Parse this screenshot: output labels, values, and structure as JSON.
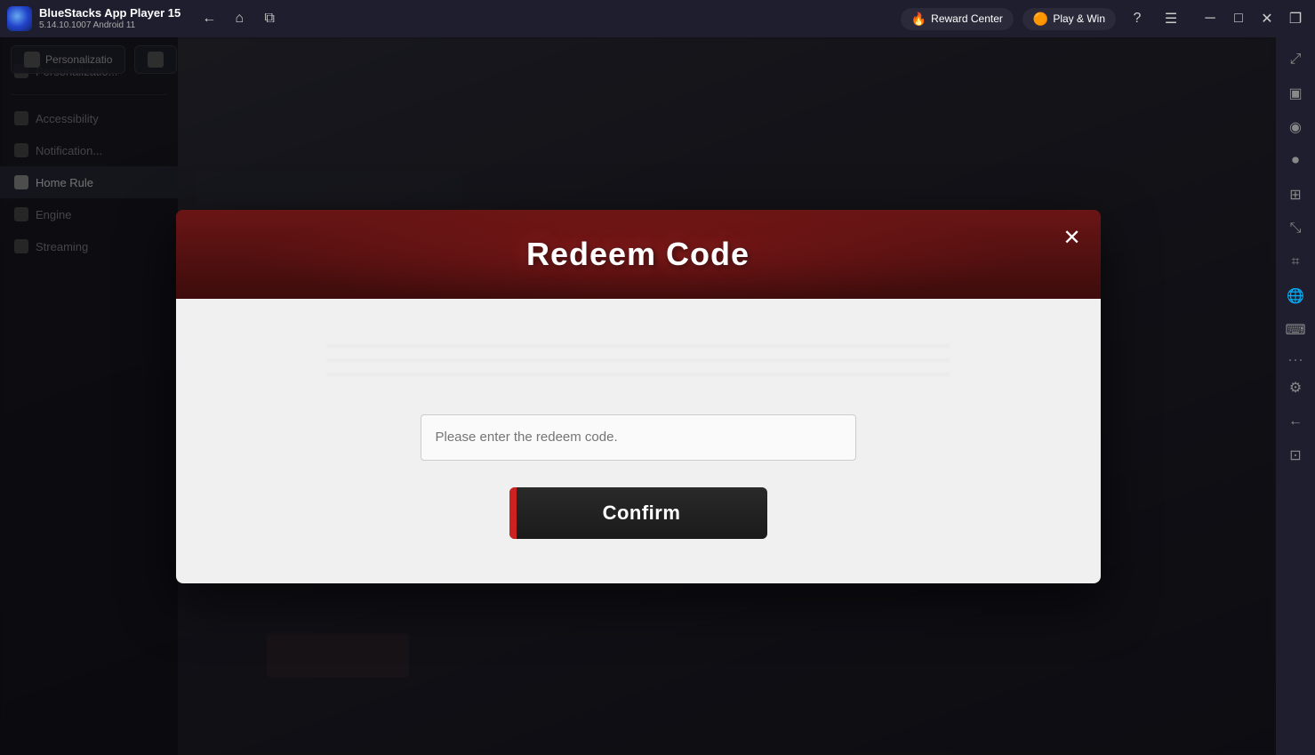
{
  "titlebar": {
    "app_name": "BlueStacks App Player 15",
    "version": "5.14.10.1007  Android 11",
    "nav": {
      "back_label": "←",
      "home_label": "⌂",
      "tabs_label": "⧉"
    },
    "badges": {
      "reward_center": "Reward Center",
      "play_and_win": "Play & Win"
    },
    "window_buttons": {
      "minimize": "─",
      "maximize": "□",
      "close": "✕",
      "restore": "❐"
    }
  },
  "right_sidebar": {
    "buttons": [
      {
        "name": "expand-icon",
        "symbol": "⤢"
      },
      {
        "name": "screenshot-icon",
        "symbol": "⬛"
      },
      {
        "name": "camera-icon",
        "symbol": "◎"
      },
      {
        "name": "record-icon",
        "symbol": "⏺"
      },
      {
        "name": "controls-icon",
        "symbol": "⊞"
      },
      {
        "name": "zoom-icon",
        "symbol": "⤡"
      },
      {
        "name": "macro-icon",
        "symbol": "⌗"
      },
      {
        "name": "globe-icon",
        "symbol": "🌐"
      },
      {
        "name": "script-icon",
        "symbol": "⌨"
      },
      {
        "name": "more-icon",
        "symbol": "···"
      },
      {
        "name": "settings-icon",
        "symbol": "⚙"
      },
      {
        "name": "arrow-left-icon",
        "symbol": "←"
      },
      {
        "name": "gamepad-icon",
        "symbol": "⊡"
      }
    ]
  },
  "left_panel": {
    "items": [
      {
        "label": "Personalization",
        "active": false
      },
      {
        "label": "",
        "active": false
      },
      {
        "label": "Accessibility",
        "active": false
      },
      {
        "label": "Notification",
        "active": false
      },
      {
        "label": "Home Rule",
        "active": true
      },
      {
        "label": "Engine",
        "active": false
      },
      {
        "label": "Streaming",
        "active": false
      }
    ]
  },
  "content_topbar": {
    "btn1_label": "Personalizatio",
    "btn2_label": ""
  },
  "modal": {
    "title": "Redeem Code",
    "close_label": "✕",
    "input_placeholder": "Please enter the redeem code.",
    "confirm_label": "Confirm"
  }
}
